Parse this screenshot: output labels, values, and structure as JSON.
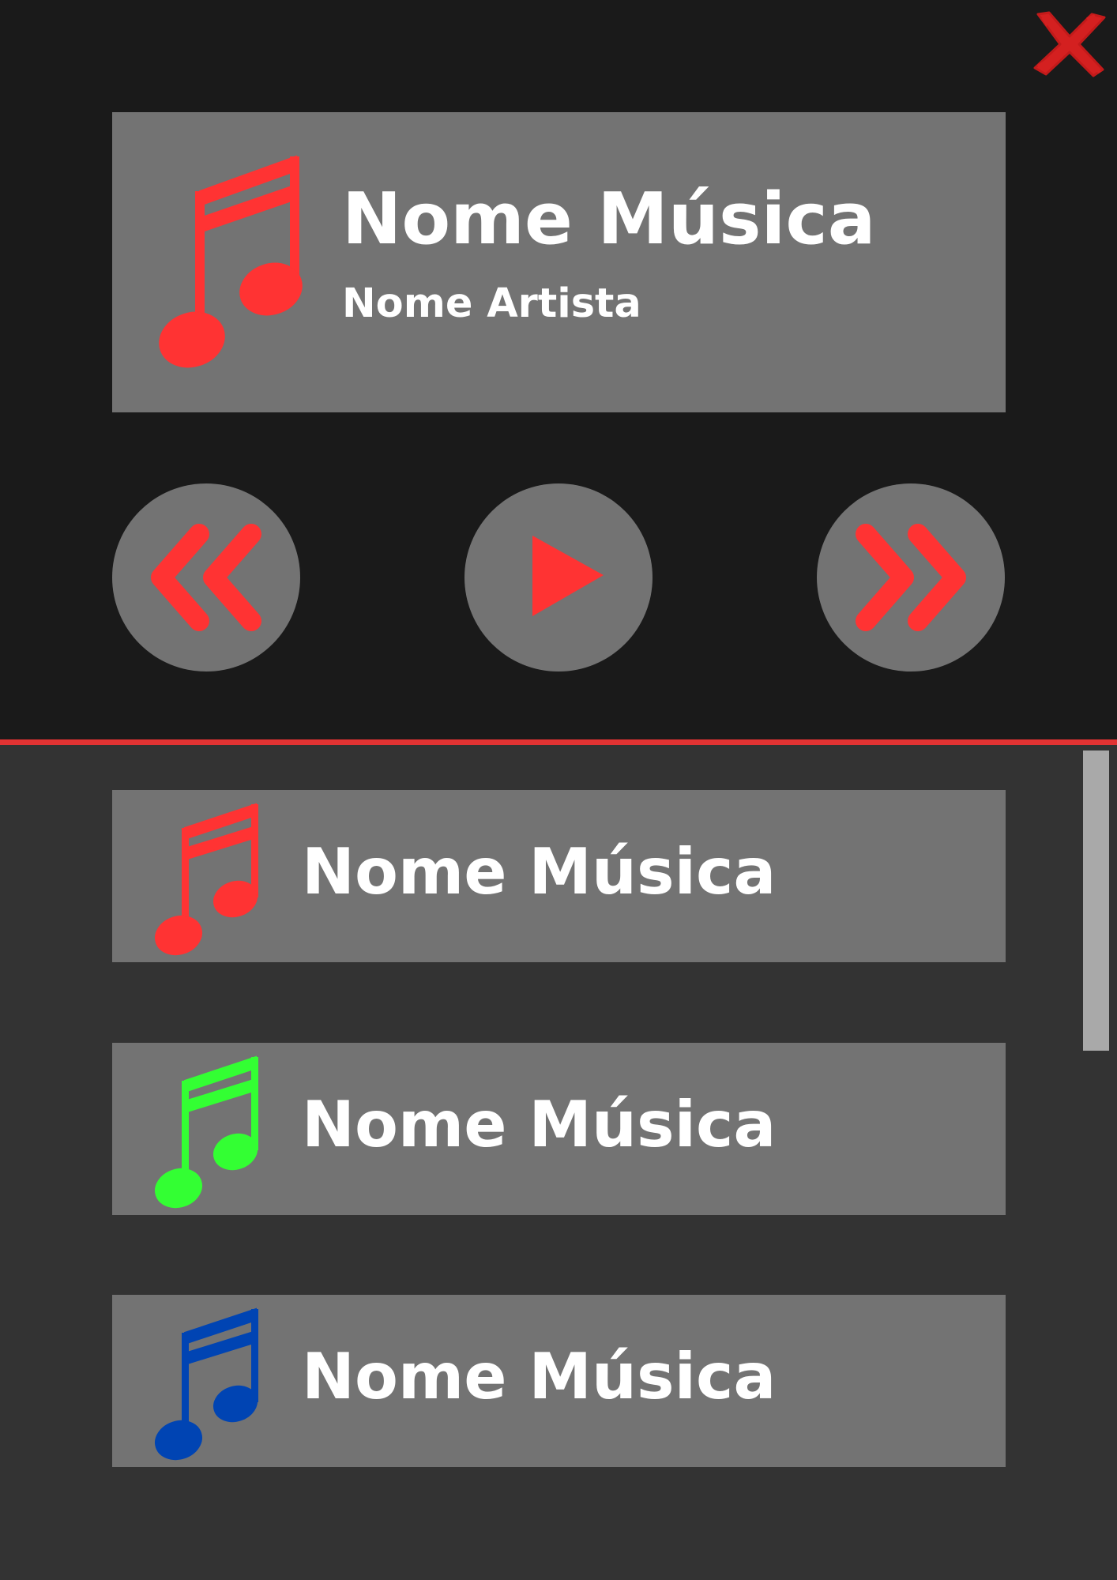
{
  "now_playing": {
    "title": "Nome Música",
    "artist": "Nome Artista",
    "note_color": "#ff3333"
  },
  "controls": {
    "previous_icon": "double-chevron-left-icon",
    "play_icon": "play-icon",
    "next_icon": "double-chevron-right-icon",
    "icon_color": "#ff3333"
  },
  "close_icon": "close-icon",
  "playlist": {
    "items": [
      {
        "title": "Nome Música",
        "note_color": "#ff3333"
      },
      {
        "title": "Nome Música",
        "note_color": "#33ff33"
      },
      {
        "title": "Nome Música",
        "note_color": "#0044b3"
      }
    ]
  },
  "colors": {
    "top_background": "#1a1a1a",
    "bottom_background": "#333333",
    "card_background": "#737373",
    "divider": "#e23333",
    "text": "#ffffff"
  }
}
